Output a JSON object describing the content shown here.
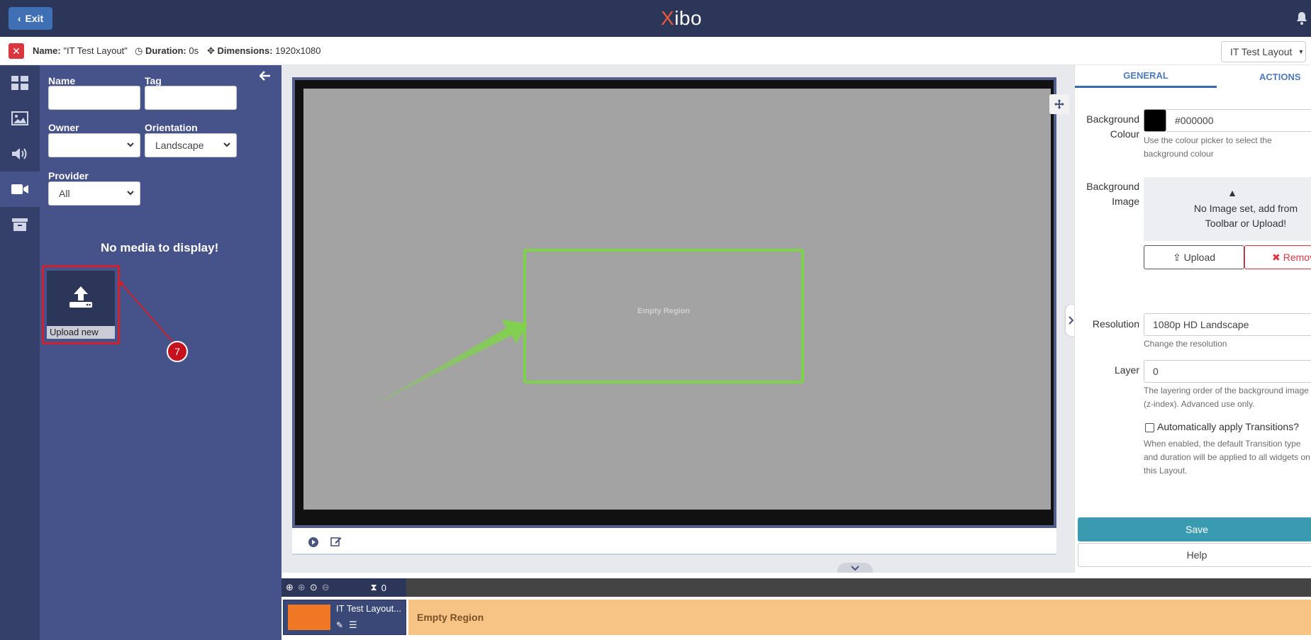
{
  "topbar": {
    "exit_label": "Exit",
    "logo_x": "X",
    "logo_rest": "ibo"
  },
  "infobar": {
    "name_label": "Name:",
    "name_value": "\"IT Test Layout\"",
    "duration_label": "Duration:",
    "duration_value": "0s",
    "dimensions_label": "Dimensions:",
    "dimensions_value": "1920x1080",
    "layout_select": "IT Test Layout"
  },
  "toolbox": {
    "name_label": "Name",
    "tag_label": "Tag",
    "owner_label": "Owner",
    "orientation_label": "Orientation",
    "orientation_value": "Landscape",
    "provider_label": "Provider",
    "provider_value": "All",
    "empty_message": "No media to display!",
    "upload_label": "Upload new",
    "step_badge": "7"
  },
  "canvas": {
    "region_label": "Empty Region"
  },
  "properties": {
    "tabs": [
      {
        "label": "GENERAL"
      },
      {
        "label": "ACTIONS"
      }
    ],
    "bg_colour_label": "Background Colour",
    "bg_colour_value": "#000000",
    "bg_colour_help": "Use the colour picker to select the background colour",
    "bg_image_label": "Background Image",
    "bg_image_empty": "No Image set, add from Toolbar or Upload!",
    "upload_button": "Upload",
    "remove_button": "Remove",
    "resolution_label": "Resolution",
    "resolution_value": "1080p HD Landscape",
    "resolution_help": "Change the resolution",
    "layer_label": "Layer",
    "layer_value": "0",
    "layer_help": "The layering order of the background image (z-index). Advanced use only.",
    "transitions_label": "Automatically apply Transitions?",
    "transitions_help": "When enabled, the default Transition type and duration will be applied to all widgets on this Layout.",
    "save_button": "Save",
    "help_button": "Help"
  },
  "timeline": {
    "duration_count": "0",
    "layout_name": "IT Test Layout...",
    "region_name": "Empty Region"
  },
  "colors": {
    "topbar": "#2c3658",
    "toolbox": "#46528a",
    "region_border": "#7fd34a",
    "save": "#3a9bb0",
    "annotation_red": "#d0202a"
  }
}
